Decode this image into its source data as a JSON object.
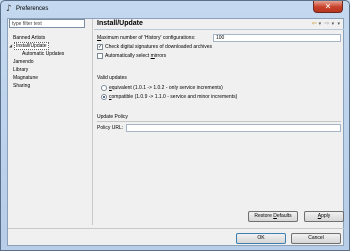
{
  "window": {
    "title": "Preferences",
    "close_glyph": "✕",
    "app_icon_glyph": "♪"
  },
  "sidebar": {
    "filter_placeholder": "type filter text",
    "items": [
      {
        "label": "Banned Artists"
      },
      {
        "label": "Install/Update",
        "toggle": "◢",
        "selected": true
      },
      {
        "label": "Automatic Updates"
      },
      {
        "label": "Jamendo"
      },
      {
        "label": "Library"
      },
      {
        "label": "Magnatune"
      },
      {
        "label": "Sharing"
      }
    ]
  },
  "page": {
    "title": "Install/Update",
    "nav": {
      "back": "⇦",
      "back_menu": "▾",
      "forward": "⇨",
      "forward_menu": "▾",
      "view_menu": "▾"
    },
    "history": {
      "label_prefix": "M",
      "label_rest": "aximum number of 'History' configurations:",
      "value": "100"
    },
    "checkboxes": [
      {
        "label": "Check digital signatures of downloaded archives",
        "checked": true,
        "mark": "✓"
      },
      {
        "label_before": "Automatically select ",
        "label_mnemonic": "m",
        "label_after": "irrors",
        "checked": false,
        "mark": ""
      }
    ],
    "valid_updates": {
      "label": "Valid updates",
      "options": [
        {
          "label_mnemonic": "e",
          "label_rest": "quivalent (1.0.1 -> 1.0.2 - only service increments)",
          "checked": false
        },
        {
          "label_mnemonic": "c",
          "label_rest": "ompatible (1.0.9 -> 1.1.0 - service and minor increments)",
          "checked": true
        }
      ]
    },
    "update_policy": {
      "label": "Update Policy",
      "url_label": "Policy URL:",
      "url_value": ""
    },
    "restore_defaults": {
      "before": "Restore ",
      "mnemonic": "D",
      "after": "efaults"
    },
    "apply": {
      "mnemonic": "A",
      "after": "pply"
    }
  },
  "dialog_buttons": {
    "ok": "OK",
    "cancel": "Cancel"
  }
}
